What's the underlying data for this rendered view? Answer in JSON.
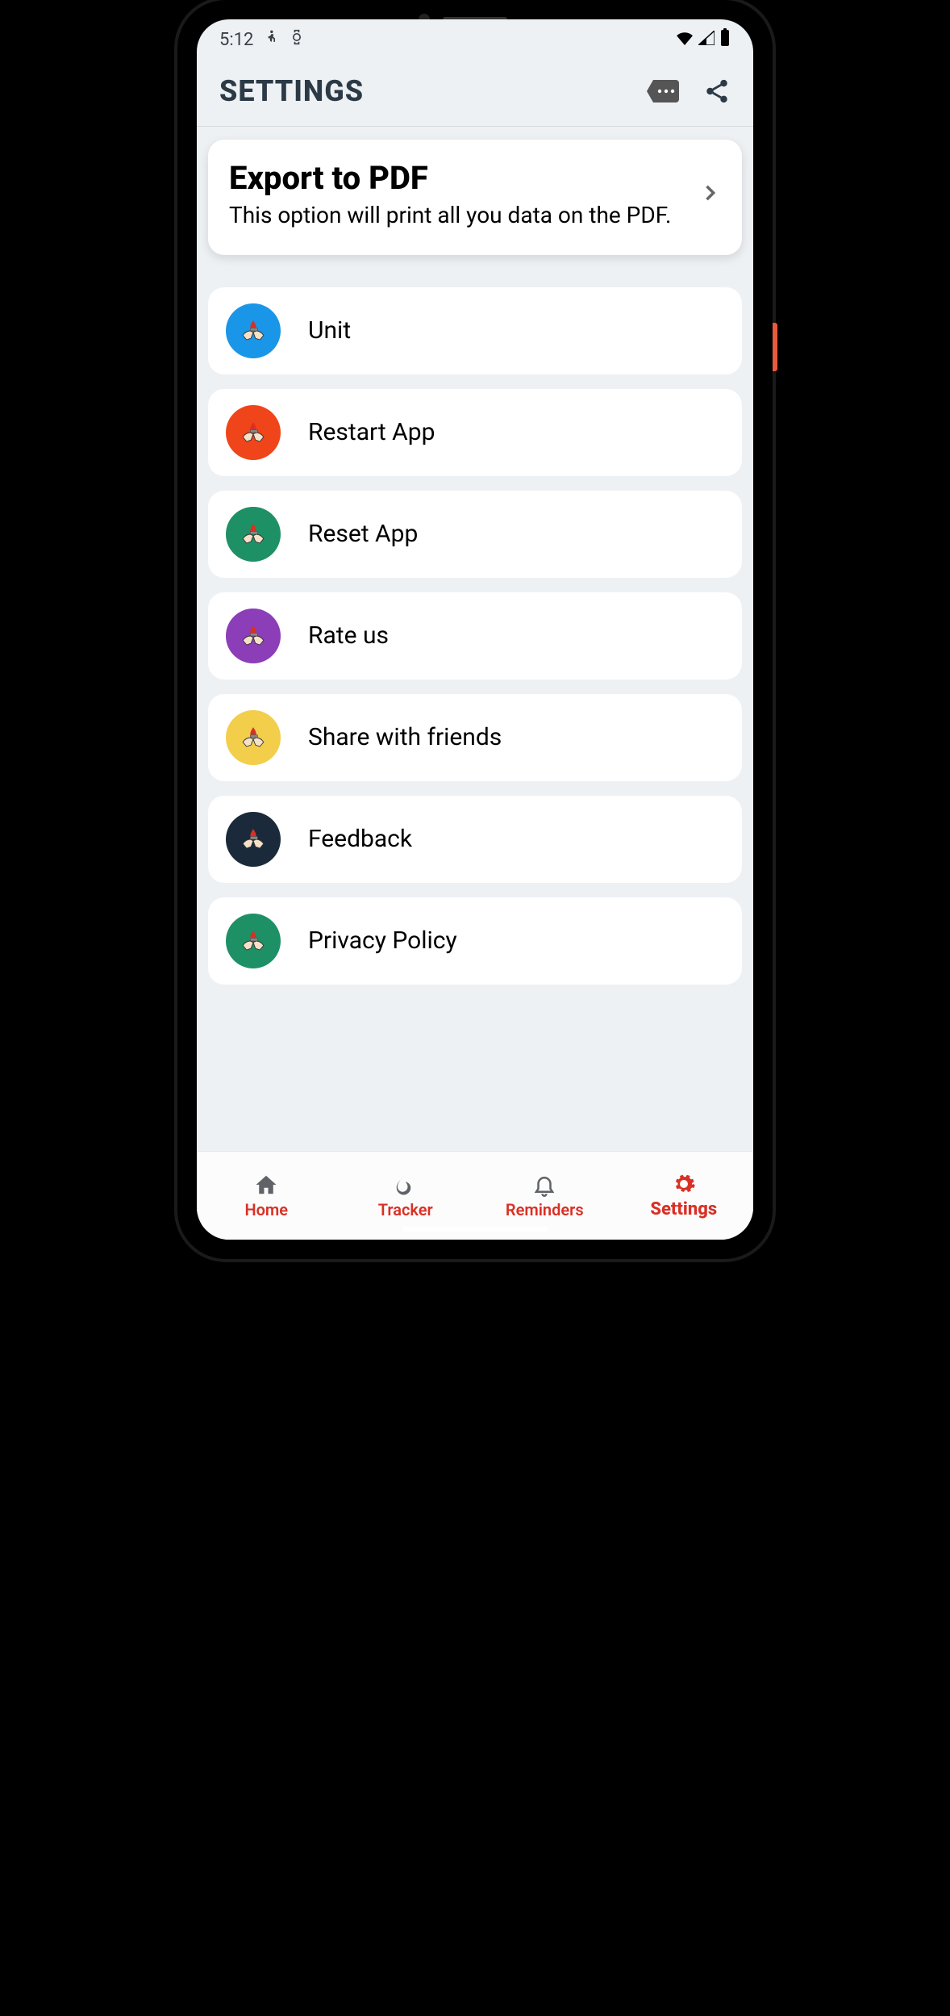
{
  "status": {
    "time": "5:12"
  },
  "header": {
    "title": "SETTINGS"
  },
  "export": {
    "title": "Export to PDF",
    "description": "This option will print all you data on the PDF."
  },
  "settings_items": [
    {
      "label": "Unit",
      "color": "#1a96e8"
    },
    {
      "label": "Restart App",
      "color": "#f0441a"
    },
    {
      "label": "Reset App",
      "color": "#1e9066"
    },
    {
      "label": "Rate us",
      "color": "#8c3db8"
    },
    {
      "label": "Share with friends",
      "color": "#f2ce4a"
    },
    {
      "label": "Feedback",
      "color": "#1a2a3a"
    },
    {
      "label": "Privacy Policy",
      "color": "#1e9066"
    }
  ],
  "nav": {
    "items": [
      {
        "label": "Home"
      },
      {
        "label": "Tracker"
      },
      {
        "label": "Reminders"
      },
      {
        "label": "Settings"
      }
    ],
    "active_index": 3
  }
}
